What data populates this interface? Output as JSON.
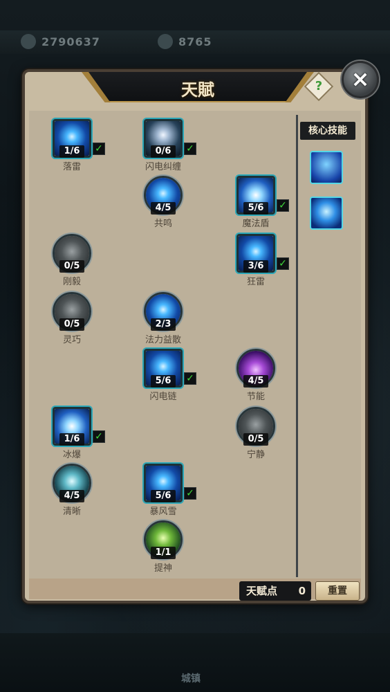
{
  "resources": {
    "coins": "2790637",
    "gems": "8765"
  },
  "panel": {
    "title": "天賦",
    "help_label": "?",
    "close_label": "×"
  },
  "core": {
    "title": "核心技能",
    "skills": [
      {
        "icon": "shield-ice-icon"
      },
      {
        "icon": "wind-slash-icon"
      }
    ]
  },
  "talents": [
    {
      "name": "落雷",
      "count": "1/6",
      "checked": true,
      "shape": "square",
      "art": "blue",
      "icon": "lightning-strike-icon"
    },
    {
      "name": "闪电纠缠",
      "count": "0/6",
      "checked": true,
      "shape": "square",
      "art": "storm",
      "icon": "lightning-tangle-icon"
    },
    {
      "name": "共鸣",
      "count": "4/5",
      "checked": false,
      "shape": "round",
      "art": "blue",
      "icon": "resonance-icon"
    },
    {
      "name": "魔法盾",
      "count": "5/6",
      "checked": true,
      "shape": "square",
      "art": "ice",
      "icon": "magic-shield-icon"
    },
    {
      "name": "刚毅",
      "count": "0/5",
      "checked": false,
      "shape": "round",
      "art": "grey",
      "icon": "fortitude-icon"
    },
    {
      "name": "狂雷",
      "count": "3/6",
      "checked": true,
      "shape": "square",
      "art": "blue",
      "icon": "raging-thunder-icon"
    },
    {
      "name": "灵巧",
      "count": "0/5",
      "checked": false,
      "shape": "round",
      "art": "grey",
      "icon": "agility-icon"
    },
    {
      "name": "法力益散",
      "count": "2/3",
      "checked": false,
      "shape": "round",
      "art": "blue",
      "icon": "mana-surge-icon"
    },
    {
      "name": "闪电链",
      "count": "5/6",
      "checked": true,
      "shape": "square",
      "art": "blue",
      "icon": "chain-lightning-icon"
    },
    {
      "name": "节能",
      "count": "4/5",
      "checked": false,
      "shape": "round",
      "art": "purple",
      "icon": "energy-saving-icon"
    },
    {
      "name": "冰爆",
      "count": "1/6",
      "checked": true,
      "shape": "square",
      "art": "ice",
      "icon": "ice-burst-icon"
    },
    {
      "name": "宁静",
      "count": "0/5",
      "checked": false,
      "shape": "round",
      "art": "grey",
      "icon": "tranquility-icon"
    },
    {
      "name": "清晰",
      "count": "4/5",
      "checked": false,
      "shape": "round",
      "art": "teal",
      "icon": "clarity-icon"
    },
    {
      "name": "暴风雪",
      "count": "5/6",
      "checked": true,
      "shape": "square",
      "art": "blue",
      "icon": "blizzard-icon"
    },
    {
      "name": "提神",
      "count": "1/1",
      "checked": false,
      "shape": "round",
      "art": "green",
      "icon": "refresh-icon"
    }
  ],
  "footer": {
    "points_label": "天赋点",
    "points_value": "0",
    "reset_label": "重置"
  },
  "bottom_nav": {
    "center_label": "城镇"
  },
  "colors": {
    "check": "#3fd83a",
    "frame_square": "#2aa7b8",
    "panel_bg": "#c8bba2"
  }
}
